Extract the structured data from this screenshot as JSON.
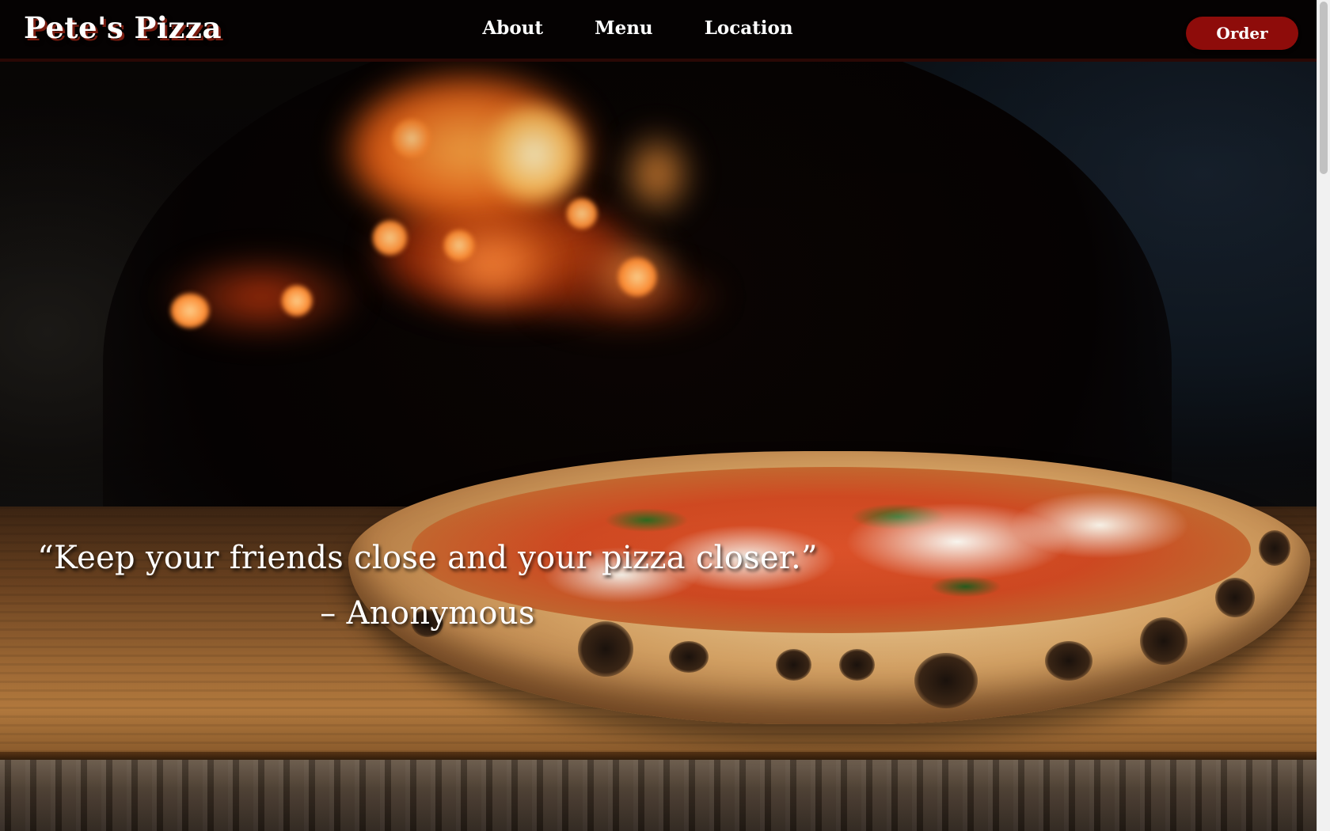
{
  "site": {
    "brand": "Pete's Pizza"
  },
  "nav": {
    "links": [
      {
        "label": "About"
      },
      {
        "label": "Menu"
      },
      {
        "label": "Location"
      }
    ],
    "order_label": "Order"
  },
  "hero": {
    "image": "wood-fired oven with margherita pizza on wooden board",
    "quote": "“Keep your friends close and your pizza closer.” – Anonymous"
  },
  "colors": {
    "navbar_bg": "#050202",
    "order_button": "#8e0c0a",
    "brand_shadow": "#7a1c10",
    "text": "#ffffff"
  },
  "scrollbar": {
    "position_fraction": 0.0
  }
}
